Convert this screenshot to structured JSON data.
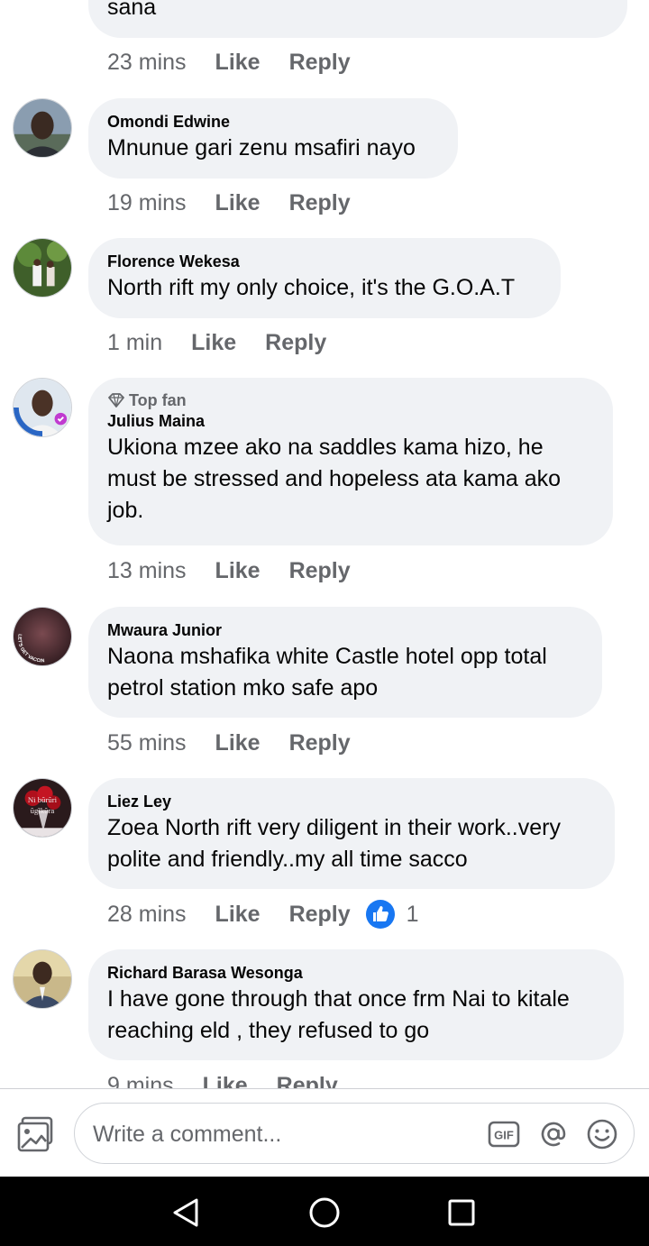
{
  "comments": [
    {
      "author": "",
      "text": "sana",
      "time": "23 mins"
    },
    {
      "author": "Omondi Edwine",
      "text": "Mnunue gari zenu msafiri nayo",
      "time": "19 mins"
    },
    {
      "author": "Florence Wekesa",
      "text": "North rift my only choice, it's the G.O.A.T",
      "time": "1 min"
    },
    {
      "author": "Julius Maina",
      "badge": "Top fan",
      "text": "Ukiona mzee ako na saddles kama hizo, he must be stressed and hopeless ata kama ako job.",
      "time": "13 mins",
      "avatar_overlay": "LET'S GET VACCINATED"
    },
    {
      "author": "Mwaura Junior",
      "text": "Naona mshafika white Castle hotel opp total petrol station mko safe apo",
      "time": "55 mins",
      "avatar_text_1": "Ni bũrũri",
      "avatar_text_2": "ũgĩkũra"
    },
    {
      "author": "Liez Ley",
      "text": "Zoea North rift very diligent in their work..very polite and friendly..my all time sacco",
      "time": "28 mins",
      "reaction_count": "1"
    },
    {
      "author": "Richard Barasa Wesonga",
      "text": "I have gone through that once frm Nai to kitale reaching eld , they refused to go",
      "time": "9 mins"
    }
  ],
  "actions": {
    "like": "Like",
    "reply": "Reply"
  },
  "composer": {
    "placeholder": "Write a comment...",
    "gif_label": "GIF"
  },
  "colors": {
    "bubble": "#f0f2f5",
    "secondary_text": "#65676b",
    "like_blue": "#1877f2",
    "nav_bg": "#000000"
  },
  "icons": [
    "photo-icon",
    "gif-icon",
    "at-mention-icon",
    "emoji-icon",
    "thumbs-up-icon",
    "back-icon",
    "home-icon",
    "recents-icon",
    "top-fan-diamond-icon"
  ]
}
